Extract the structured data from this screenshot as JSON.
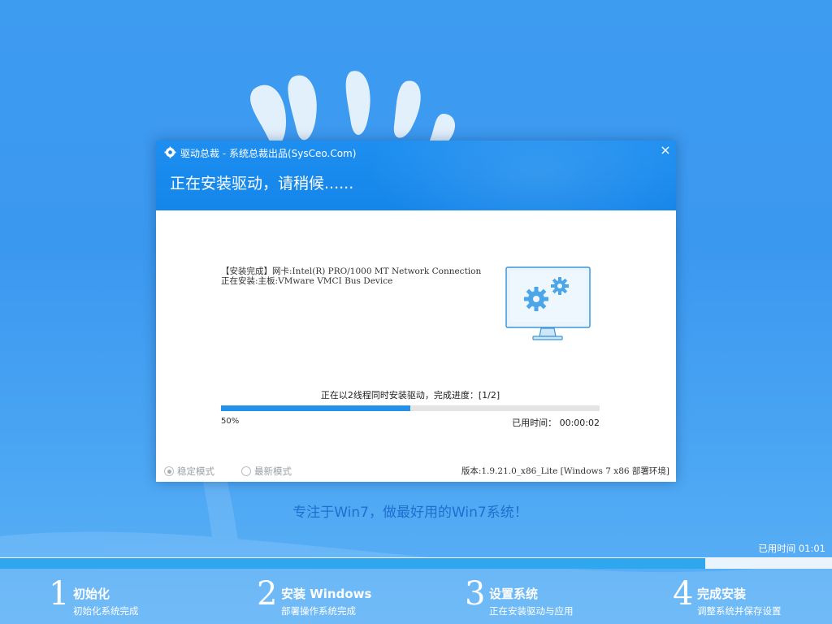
{
  "window": {
    "title": "驱动总裁 - 系统总裁出品(SysCeo.Com)",
    "heading": "正在安装驱动，请稍候......",
    "close_symbol": "×"
  },
  "log_lines": [
    "【安装完成】网卡:Intel(R) PRO/1000 MT Network Connection",
    "正在安装:主板:VMware VMCI Bus Device"
  ],
  "progress": {
    "caption": "正在以2线程同时安装驱动，完成进度：[1/2]",
    "percent_label": "50%",
    "percent": 50,
    "elapsed_label": "已用时间：",
    "elapsed_value": "00:00:02"
  },
  "modes": [
    {
      "label": "稳定模式",
      "selected": true
    },
    {
      "label": "最新模式",
      "selected": false
    }
  ],
  "version": "版本:1.9.21.0_x86_Lite [Windows 7 x86 部署环境]",
  "slogan": "专注于Win7，做最好用的Win7系统！",
  "total": {
    "elapsed_text": "已用时间 01:01",
    "progress_fraction": 0.848
  },
  "steps": [
    {
      "num": "1",
      "title": "初始化",
      "subtitle": "初始化系统完成"
    },
    {
      "num": "2",
      "title": "安装 Windows",
      "subtitle": "部署操作系统完成"
    },
    {
      "num": "3",
      "title": "设置系统",
      "subtitle": "正在安装驱动与应用"
    },
    {
      "num": "4",
      "title": "完成安装",
      "subtitle": "调整系统并保存设置"
    }
  ],
  "colors": {
    "background": "#3d9bf0",
    "header": "#1485ea",
    "accent": "#2590ea",
    "slogan": "#1f6fcf"
  },
  "icons": {
    "app": "gear-logo-icon",
    "close": "close-icon",
    "illustration": "monitor-gears-icon"
  }
}
